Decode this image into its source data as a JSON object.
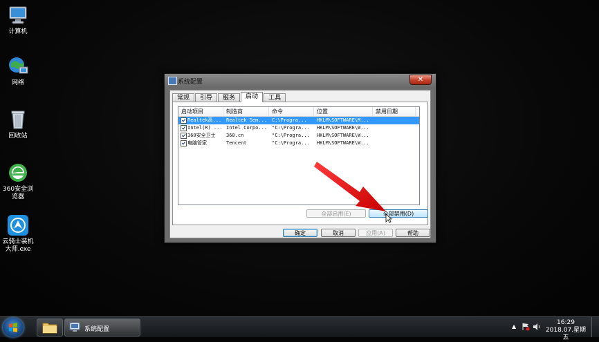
{
  "desktop": {
    "icons": [
      {
        "name": "computer",
        "label": "计算机"
      },
      {
        "name": "network",
        "label": "网络"
      },
      {
        "name": "recycle-bin",
        "label": "回收站"
      },
      {
        "name": "browser-360",
        "label": "360安全浏览器"
      },
      {
        "name": "installer",
        "label": "云骑士装机大师.exe"
      }
    ]
  },
  "window": {
    "title": "系统配置",
    "close_label": "✕",
    "tabs": [
      "常规",
      "引导",
      "服务",
      "启动",
      "工具"
    ],
    "active_tab": "启动",
    "columns": [
      "启动项目",
      "制造商",
      "命令",
      "位置",
      "禁用日期"
    ],
    "rows": [
      {
        "item": "Realtek高...",
        "maker": "Realtek Sem...",
        "command": "C:\\Progra...",
        "location": "HKLM\\SOFTWARE\\M...",
        "date": "",
        "selected": true
      },
      {
        "item": "Intel(R) ...",
        "maker": "Intel Corpo...",
        "command": "\"C:\\Progra...",
        "location": "HKLM\\SOFTWARE\\W...",
        "date": "",
        "selected": false
      },
      {
        "item": "360安全卫士",
        "maker": "360.cn",
        "command": "\"C:\\Progra...",
        "location": "HKLM\\SOFTWARE\\W...",
        "date": "",
        "selected": false
      },
      {
        "item": "电脑管家",
        "maker": "Tencent",
        "command": "\"C:\\Progra...",
        "location": "HKLM\\SOFTWARE\\W...",
        "date": "",
        "selected": false
      }
    ],
    "enable_all": "全部启用(E)",
    "disable_all": "全部禁用(D)",
    "ok": "确定",
    "cancel": "取消",
    "apply": "应用(A)",
    "help": "帮助"
  },
  "taskbar": {
    "task_label": "系统配置",
    "time": "16:29",
    "date": "2018.07.星期五"
  },
  "colors": {
    "selection": "#3399ff",
    "arrow": "#e01010"
  }
}
